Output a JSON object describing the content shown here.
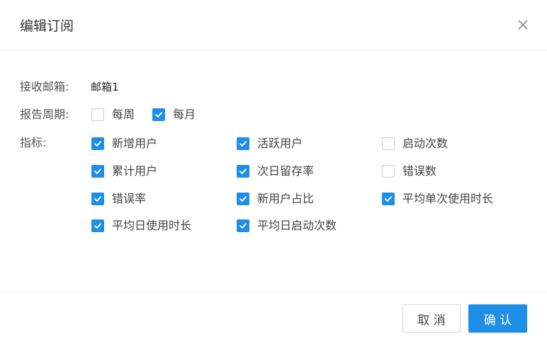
{
  "dialog": {
    "title": "编辑订阅",
    "close_icon": "close-icon"
  },
  "email": {
    "label": "接收邮箱:",
    "value": "邮箱1"
  },
  "period": {
    "label": "报告周期:",
    "options": [
      {
        "label": "每周",
        "checked": false
      },
      {
        "label": "每月",
        "checked": true
      }
    ]
  },
  "metrics": {
    "label": "指标:",
    "options": [
      {
        "label": "新增用户",
        "checked": true
      },
      {
        "label": "活跃用户",
        "checked": true
      },
      {
        "label": "启动次数",
        "checked": false
      },
      {
        "label": "累计用户",
        "checked": true
      },
      {
        "label": "次日留存率",
        "checked": true
      },
      {
        "label": "错误数",
        "checked": false
      },
      {
        "label": "错误率",
        "checked": true
      },
      {
        "label": "新用户占比",
        "checked": true
      },
      {
        "label": "平均单次使用时长",
        "checked": true
      },
      {
        "label": "平均日使用时长",
        "checked": true
      },
      {
        "label": "平均日启动次数",
        "checked": true
      }
    ]
  },
  "footer": {
    "cancel_label": "取 消",
    "confirm_label": "确 认"
  },
  "colors": {
    "accent": "#1e8ee6",
    "border": "#e8e8e8"
  }
}
